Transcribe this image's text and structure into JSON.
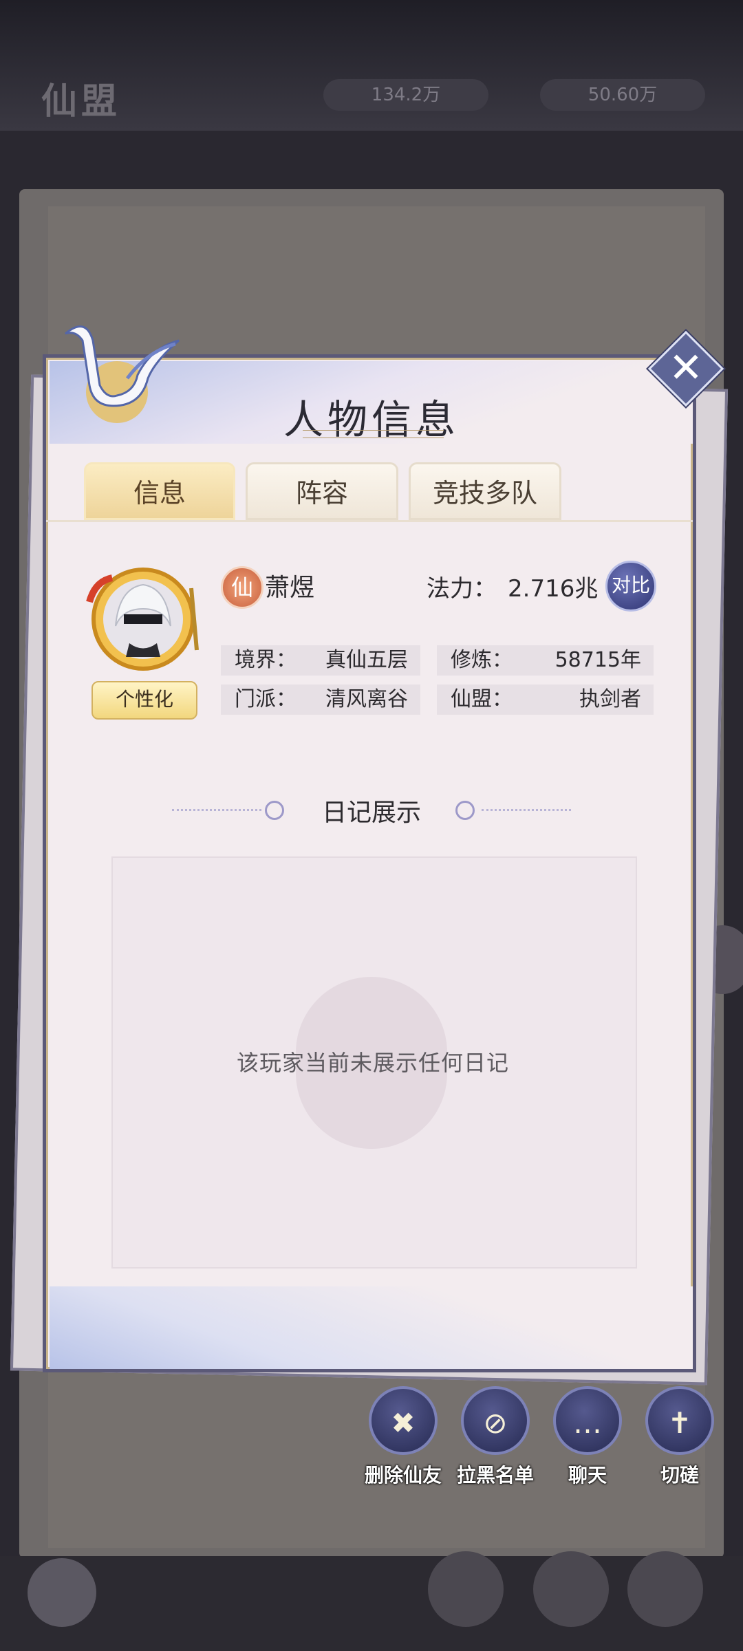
{
  "background": {
    "title": "仙盟",
    "res1": "134.2万",
    "res2": "50.60万"
  },
  "modal": {
    "title": "人物信息",
    "close_label": "✕"
  },
  "tabs": [
    {
      "label": "信息",
      "active": true
    },
    {
      "label": "阵容",
      "active": false
    },
    {
      "label": "竞技多队",
      "active": false
    }
  ],
  "profile": {
    "personalize_label": "个性化",
    "realm_badge": "仙",
    "name": "萧煜",
    "power_label": "法力：",
    "power_value": "2.716兆",
    "compare_label": "对比",
    "stats": [
      {
        "key": "境界：",
        "value": "真仙五层"
      },
      {
        "key": "修炼：",
        "value": "58715年"
      },
      {
        "key": "门派：",
        "value": "清风离谷"
      },
      {
        "key": "仙盟：",
        "value": "执剑者"
      }
    ]
  },
  "diary": {
    "title": "日记展示",
    "empty_text": "该玩家当前未展示任何日记"
  },
  "actions": [
    {
      "label": "删除仙友",
      "icon": "remove-friend-icon",
      "glyph": "✖"
    },
    {
      "label": "拉黑名单",
      "icon": "block-icon",
      "glyph": "⊘"
    },
    {
      "label": "聊天",
      "icon": "chat-icon",
      "glyph": "…"
    },
    {
      "label": "切磋",
      "icon": "sword-icon",
      "glyph": "✝"
    }
  ],
  "colors": {
    "accent": "#5d6596",
    "tab_active": "#eed49a",
    "card_bg": "#f3ecef"
  }
}
